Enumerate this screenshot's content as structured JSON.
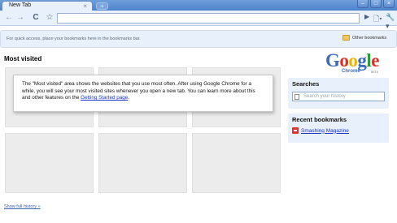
{
  "window": {
    "tab_title": "New Tab",
    "tab_close": "×",
    "new_tab": "+",
    "controls": {
      "minimize": "–",
      "maximize": "□",
      "close": "×"
    }
  },
  "toolbar": {
    "back_glyph": "←",
    "forward_glyph": "→",
    "reload_glyph": "C",
    "star_glyph": "☆",
    "address_value": "",
    "go_glyph": "▶",
    "page_menu_glyph": "🗋▾",
    "wrench_glyph": "🔧▾"
  },
  "bookmark_bar": {
    "hint": "For quick access, place your bookmarks here in the bookmarks bar.",
    "other_bookmarks": "Other bookmarks"
  },
  "most_visited": {
    "title": "Most visited",
    "note_text": "The \"Most visited\" area shows the websites that you use most often. After using Google Chrome for a while, you will see your most visited sites whenever you open a new tab. You can learn more about this and other features on the ",
    "note_link": "Getting Started page",
    "note_end": ".",
    "show_history": "Show full history »"
  },
  "logo": {
    "letters": [
      {
        "ch": "G",
        "color": "#3f6ab6"
      },
      {
        "ch": "o",
        "color": "#d93025"
      },
      {
        "ch": "o",
        "color": "#f0b400"
      },
      {
        "ch": "g",
        "color": "#3f6ab6"
      },
      {
        "ch": "l",
        "color": "#2e9a3a"
      },
      {
        "ch": "e",
        "color": "#d93025"
      }
    ],
    "sub": "Chrome",
    "beta": "BETA"
  },
  "searches": {
    "title": "Searches",
    "placeholder": "Search your history"
  },
  "recent_bookmarks": {
    "title": "Recent bookmarks",
    "items": [
      {
        "label": "Smashing Magazine"
      }
    ]
  },
  "colors": {
    "accent": "#e8f0fb",
    "link": "#1a33cc",
    "frame": "#4d82cc"
  }
}
